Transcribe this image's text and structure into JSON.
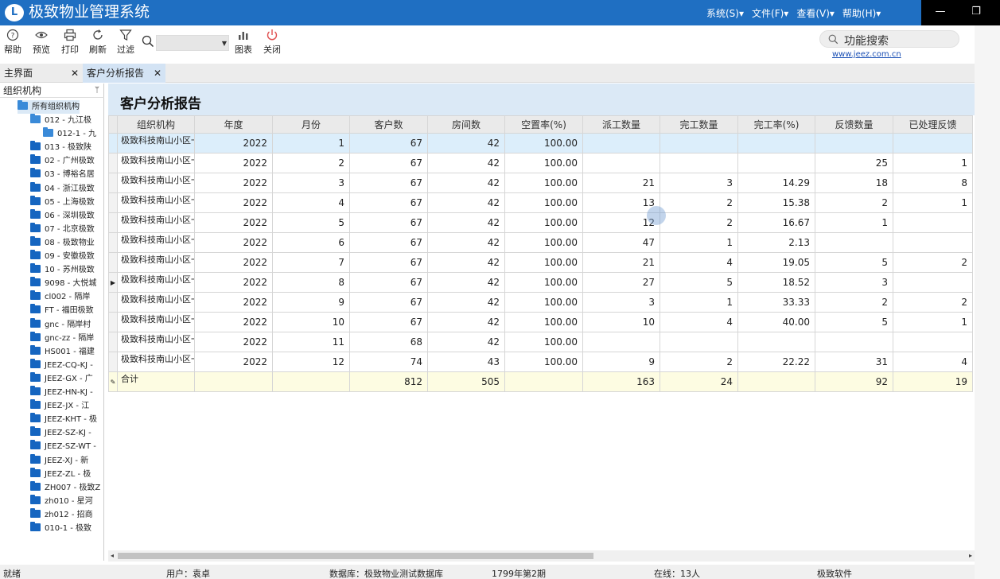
{
  "app": {
    "logo_glyph": "L",
    "title": "极致物业管理系统"
  },
  "menus": [
    "系统(S)▾",
    "文件(F)▾",
    "查看(V)▾",
    "帮助(H)▾"
  ],
  "window_controls": {
    "minimize": "—",
    "restore": "❐"
  },
  "toolbar": {
    "help": "帮助",
    "preview": "预览",
    "print": "打印",
    "refresh": "刷新",
    "filter": "过滤",
    "chart": "图表",
    "close": "关闭",
    "search_value": "",
    "func_search": "功能搜索",
    "website": "www.jeez.com.cn"
  },
  "tabs": [
    {
      "label": "主界面",
      "close": "✕"
    },
    {
      "label": "客户分析报告",
      "close": "✕"
    }
  ],
  "left_panel": {
    "title": "组织机构",
    "pin": "ᛘ",
    "nodes": [
      "所有组织机构",
      "012 - 九江极",
      "012-1 - 九",
      "013 - 极致陕",
      "02 - 广州极致",
      "03 - 博裕名居",
      "04 - 浙江极致",
      "05 - 上海极致",
      "06 - 深圳极致",
      "07 - 北京极致",
      "08 - 极致物业",
      "09 - 安徽极致",
      "10 - 苏州极致",
      "9098 - 大悦城",
      "cl002 - 隔岸",
      "FT - 福田极致",
      "gnc - 隔岸村",
      "gnc-zz - 隔岸",
      "HS001 - 福建",
      "JEEZ-CQ-KJ -",
      "JEEZ-GX - 广",
      "JEEZ-HN-KJ -",
      "JEEZ-JX - 江",
      "JEEZ-KHT - 极",
      "JEEZ-SZ-KJ -",
      "JEEZ-SZ-WT -",
      "JEEZ-XJ - 新",
      "JEEZ-ZL - 极",
      "ZH007 - 极致Z",
      "zh010 - 星河",
      "zh012 - 招商",
      "010-1 - 极致"
    ]
  },
  "report": {
    "title": "客户分析报告",
    "columns": [
      "组织机构",
      "年度",
      "月份",
      "客户数",
      "房间数",
      "空置率(%)",
      "派工数量",
      "完工数量",
      "完工率(%)",
      "反馈数量",
      "已处理反馈"
    ],
    "rows": [
      [
        "极致科技南山小区一期",
        "2022",
        "1",
        "67",
        "42",
        "100.00",
        "",
        "",
        "",
        "",
        ""
      ],
      [
        "极致科技南山小区一期",
        "2022",
        "2",
        "67",
        "42",
        "100.00",
        "",
        "",
        "",
        "25",
        "1"
      ],
      [
        "极致科技南山小区一期",
        "2022",
        "3",
        "67",
        "42",
        "100.00",
        "21",
        "3",
        "14.29",
        "18",
        "8"
      ],
      [
        "极致科技南山小区一期",
        "2022",
        "4",
        "67",
        "42",
        "100.00",
        "13",
        "2",
        "15.38",
        "2",
        "1"
      ],
      [
        "极致科技南山小区一期",
        "2022",
        "5",
        "67",
        "42",
        "100.00",
        "12",
        "2",
        "16.67",
        "1",
        ""
      ],
      [
        "极致科技南山小区一期",
        "2022",
        "6",
        "67",
        "42",
        "100.00",
        "47",
        "1",
        "2.13",
        "",
        ""
      ],
      [
        "极致科技南山小区一期",
        "2022",
        "7",
        "67",
        "42",
        "100.00",
        "21",
        "4",
        "19.05",
        "5",
        "2"
      ],
      [
        "极致科技南山小区一期",
        "2022",
        "8",
        "67",
        "42",
        "100.00",
        "27",
        "5",
        "18.52",
        "3",
        ""
      ],
      [
        "极致科技南山小区一期",
        "2022",
        "9",
        "67",
        "42",
        "100.00",
        "3",
        "1",
        "33.33",
        "2",
        "2"
      ],
      [
        "极致科技南山小区一期",
        "2022",
        "10",
        "67",
        "42",
        "100.00",
        "10",
        "4",
        "40.00",
        "5",
        "1"
      ],
      [
        "极致科技南山小区一期",
        "2022",
        "11",
        "68",
        "42",
        "100.00",
        "",
        "",
        "",
        "",
        ""
      ],
      [
        "极致科技南山小区一期",
        "2022",
        "12",
        "74",
        "43",
        "100.00",
        "9",
        "2",
        "22.22",
        "31",
        "4"
      ]
    ],
    "total_row": [
      "合计",
      "",
      "",
      "812",
      "505",
      "",
      "163",
      "24",
      "",
      "92",
      "19"
    ],
    "selected_row_index": 0,
    "current_row_index": 7
  },
  "scroll": {
    "left": "◂",
    "right": "▸"
  },
  "status": {
    "ready": "就绪",
    "user": "用户：袁卓",
    "database": "数据库：极致物业测试数据库",
    "period": "1799年第2期",
    "online": "在线：13人",
    "company": "极致软件"
  }
}
